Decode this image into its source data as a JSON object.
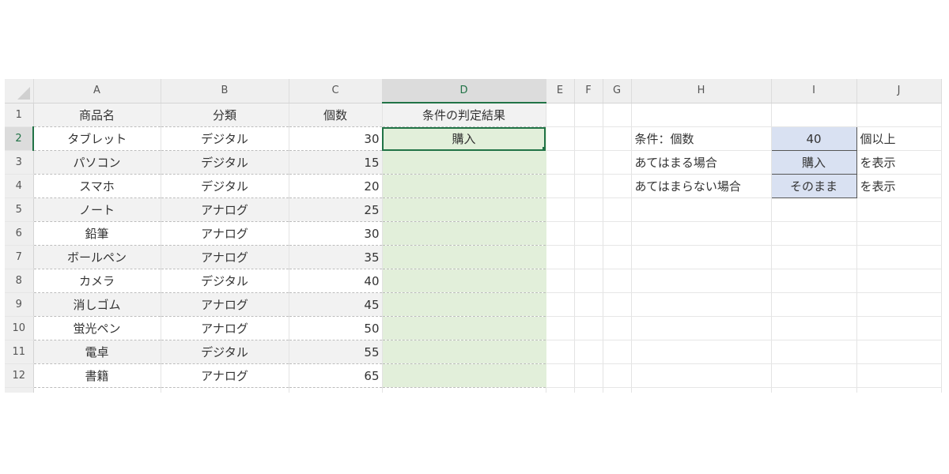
{
  "columns": [
    "A",
    "B",
    "C",
    "D",
    "E",
    "F",
    "G",
    "H",
    "I",
    "J"
  ],
  "selected_column": "D",
  "selected_row": "2",
  "row_numbers": [
    "1",
    "2",
    "3",
    "4",
    "5",
    "6",
    "7",
    "8",
    "9",
    "10",
    "11",
    "12"
  ],
  "headers": {
    "name": "商品名",
    "category": "分類",
    "count": "個数",
    "result": "条件の判定結果"
  },
  "rows": [
    {
      "name": "タブレット",
      "category": "デジタル",
      "count": "30",
      "result": "購入"
    },
    {
      "name": "パソコン",
      "category": "デジタル",
      "count": "15",
      "result": ""
    },
    {
      "name": "スマホ",
      "category": "デジタル",
      "count": "20",
      "result": ""
    },
    {
      "name": "ノート",
      "category": "アナログ",
      "count": "25",
      "result": ""
    },
    {
      "name": "鉛筆",
      "category": "アナログ",
      "count": "30",
      "result": ""
    },
    {
      "name": "ボールペン",
      "category": "アナログ",
      "count": "35",
      "result": ""
    },
    {
      "name": "カメラ",
      "category": "デジタル",
      "count": "40",
      "result": ""
    },
    {
      "name": "消しゴム",
      "category": "アナログ",
      "count": "45",
      "result": ""
    },
    {
      "name": "蛍光ペン",
      "category": "アナログ",
      "count": "50",
      "result": ""
    },
    {
      "name": "電卓",
      "category": "デジタル",
      "count": "55",
      "result": ""
    },
    {
      "name": "書籍",
      "category": "アナログ",
      "count": "65",
      "result": ""
    }
  ],
  "conditions": [
    {
      "label": "条件：個数",
      "value": "40",
      "suffix": "個以上"
    },
    {
      "label": "あてはまる場合",
      "value": "購入",
      "suffix": "を表示"
    },
    {
      "label": "あてはまらない場合",
      "value": "そのまま",
      "suffix": "を表示"
    }
  ],
  "colors": {
    "selection": "#217346",
    "result_fill": "#e2efda",
    "condition_fill": "#d9e1f2"
  }
}
